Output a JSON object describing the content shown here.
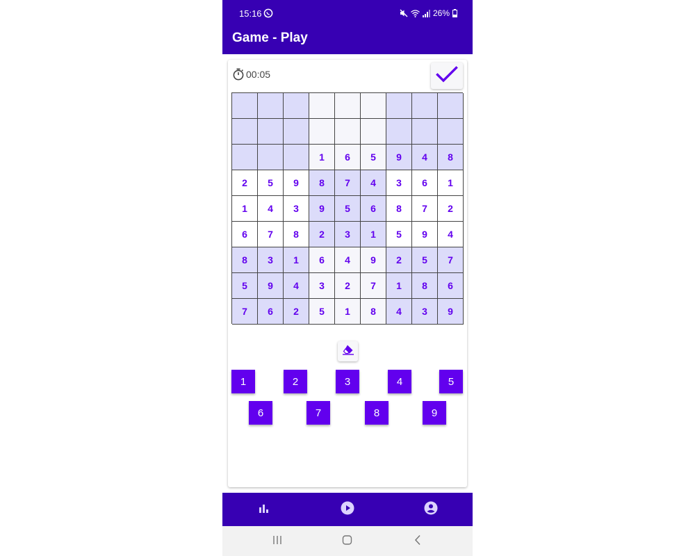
{
  "status_bar": {
    "time": "15:16",
    "battery": "26%"
  },
  "app_bar": {
    "title": "Game - Play"
  },
  "timer": {
    "value": "00:05"
  },
  "board": {
    "rows": [
      [
        "",
        "",
        "",
        "",
        "",
        "",
        "",
        "",
        ""
      ],
      [
        "",
        "",
        "",
        "",
        "",
        "",
        "",
        "",
        ""
      ],
      [
        "",
        "",
        "",
        "1",
        "6",
        "5",
        "9",
        "4",
        "8"
      ],
      [
        "2",
        "5",
        "9",
        "8",
        "7",
        "4",
        "3",
        "6",
        "1"
      ],
      [
        "1",
        "4",
        "3",
        "9",
        "5",
        "6",
        "8",
        "7",
        "2"
      ],
      [
        "6",
        "7",
        "8",
        "2",
        "3",
        "1",
        "5",
        "9",
        "4"
      ],
      [
        "8",
        "3",
        "1",
        "6",
        "4",
        "9",
        "2",
        "5",
        "7"
      ],
      [
        "5",
        "9",
        "4",
        "3",
        "2",
        "7",
        "1",
        "8",
        "6"
      ],
      [
        "7",
        "6",
        "2",
        "5",
        "1",
        "8",
        "4",
        "3",
        "9"
      ]
    ]
  },
  "keypad": {
    "keys": [
      "1",
      "2",
      "3",
      "4",
      "5",
      "6",
      "7",
      "8",
      "9"
    ]
  },
  "icons": {
    "timer": "stopwatch-icon",
    "check": "check-icon",
    "eraser": "eraser-icon",
    "nav_stats": "bar-chart-icon",
    "nav_play": "play-circle-icon",
    "nav_profile": "account-circle-icon"
  },
  "colors": {
    "app_bar": "#3700b3",
    "accent": "#6200ee",
    "cell_shade": "#dcdcfa",
    "cell_light": "#f6f6fb"
  }
}
